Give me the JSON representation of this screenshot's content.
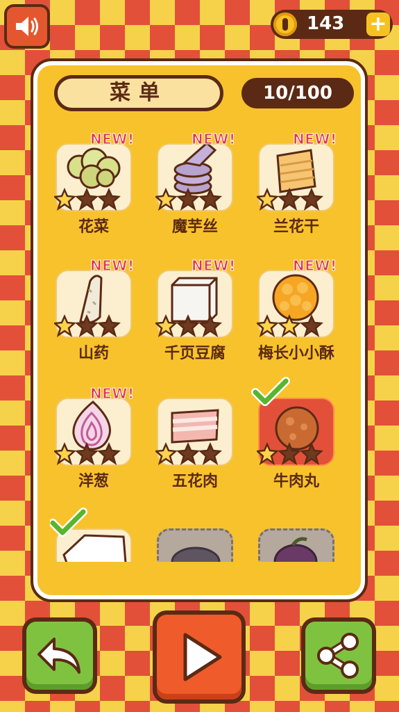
{
  "header": {
    "sound_icon": "speaker-icon",
    "coins": "143",
    "coin_icon": "coin-icon",
    "plus_label": "+"
  },
  "panel": {
    "title": "菜单",
    "progress": "10/100"
  },
  "items": [
    {
      "name": "花菜",
      "new_label": "NEW!",
      "stars": 1,
      "state": "new",
      "food": "cauliflower"
    },
    {
      "name": "魔芋丝",
      "new_label": "NEW!",
      "stars": 1,
      "state": "new",
      "food": "konjac"
    },
    {
      "name": "兰花干",
      "new_label": "NEW!",
      "stars": 1,
      "state": "new",
      "food": "tofu-skin"
    },
    {
      "name": "山药",
      "new_label": "NEW!",
      "stars": 1,
      "state": "new",
      "food": "yam"
    },
    {
      "name": "千页豆腐",
      "new_label": "NEW!",
      "stars": 1,
      "state": "new",
      "food": "tofu"
    },
    {
      "name": "梅长小小酥",
      "new_label": "NEW!",
      "stars": 2,
      "state": "new",
      "food": "crispy"
    },
    {
      "name": "洋葱",
      "new_label": "NEW!",
      "stars": 1,
      "state": "new",
      "food": "onion"
    },
    {
      "name": "五花肉",
      "new_label": "",
      "stars": 1,
      "state": "normal",
      "food": "pork-belly"
    },
    {
      "name": "牛肉丸",
      "new_label": "",
      "stars": 1,
      "state": "checked",
      "food": "meatball"
    },
    {
      "name": "",
      "new_label": "",
      "stars": 0,
      "state": "checked",
      "food": "white-box"
    },
    {
      "name": "",
      "new_label": "",
      "stars": 0,
      "state": "locked",
      "food": "dark-bowl"
    },
    {
      "name": "",
      "new_label": "",
      "stars": 0,
      "state": "locked",
      "food": "eggplant"
    }
  ],
  "buttons": {
    "back_icon": "back-arrow-icon",
    "play_icon": "play-icon",
    "share_icon": "share-icon"
  },
  "colors": {
    "brown": "#5b2a14",
    "panel": "#f8c22c",
    "red": "#e2503a",
    "new": "#e3344e",
    "green": "#7fc23f",
    "orange": "#ef5b2a"
  }
}
